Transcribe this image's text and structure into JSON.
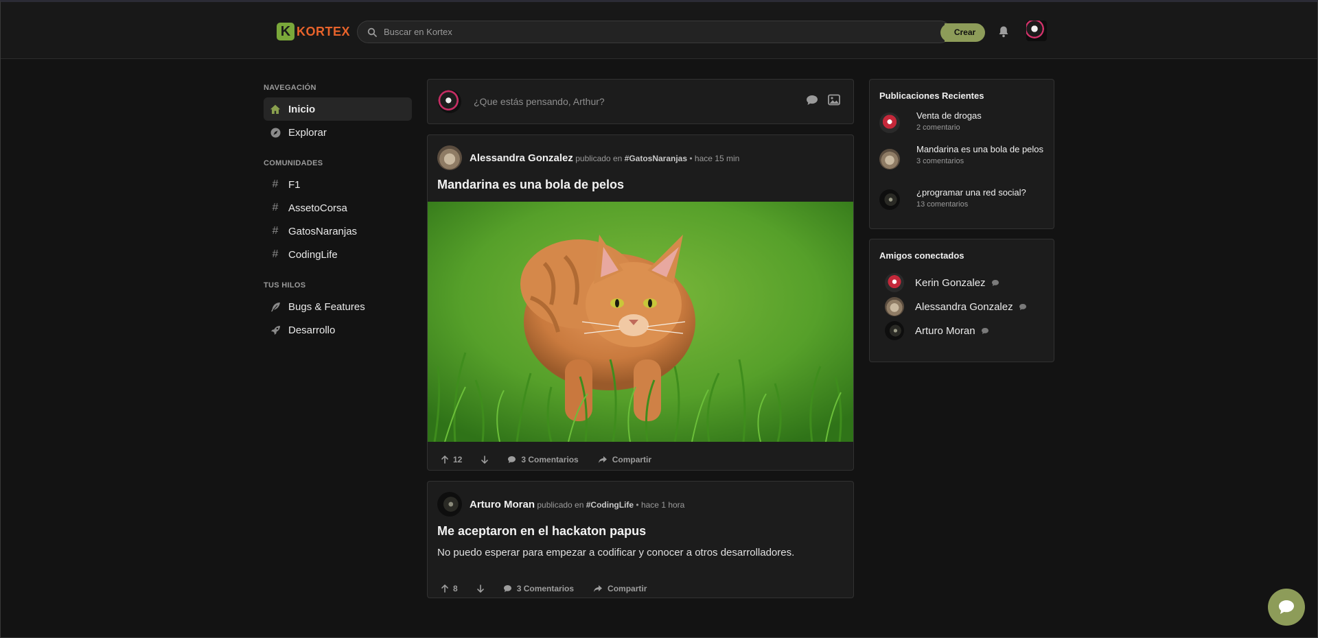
{
  "header": {
    "logo_letter": "K",
    "logo_text": "KORTEX",
    "search_placeholder": "Buscar en Kortex",
    "create_label": "Crear"
  },
  "sidebar": {
    "nav_heading": "NAVEGACIÓN",
    "nav_items": [
      {
        "label": "Inicio",
        "icon": "home-icon",
        "active": true
      },
      {
        "label": "Explorar",
        "icon": "compass-icon",
        "active": false
      }
    ],
    "communities_heading": "COMUNIDADES",
    "communities": [
      {
        "label": "F1",
        "icon": "#"
      },
      {
        "label": "AssetoCorsa",
        "icon": "#"
      },
      {
        "label": "GatosNaranjas",
        "icon": "#"
      },
      {
        "label": "CodingLife",
        "icon": "#"
      }
    ],
    "threads_heading": "TUS HILOS",
    "threads": [
      {
        "label": "Bugs & Features",
        "icon": "feather-icon"
      },
      {
        "label": "Desarrollo",
        "icon": "rocket-icon"
      }
    ]
  },
  "composer": {
    "placeholder": "¿Que estás pensando, Arthur?"
  },
  "posts": [
    {
      "author": "Alessandra Gonzalez",
      "posted_in": "publicado en",
      "community": "#GatosNaranjas",
      "time": "• hace 15 min",
      "title": "Mandarina es una bola de pelos",
      "upvotes": "12",
      "comments": "3 Comentarios",
      "share": "Compartir"
    },
    {
      "author": "Arturo Moran",
      "posted_in": "publicado en",
      "community": "#CodingLife",
      "time": "• hace 1 hora",
      "title": "Me aceptaron en el hackaton papus",
      "body": "No puedo esperar para empezar a codificar y conocer a otros desarrolladores.",
      "upvotes": "8",
      "comments": "3 Comentarios",
      "share": "Compartir"
    }
  ],
  "recent": {
    "title": "Publicaciones Recientes",
    "items": [
      {
        "title": "Venta de drogas",
        "sub": "2 comentario"
      },
      {
        "title": "Mandarina es una bola de pelos",
        "sub": "3 comentarios"
      },
      {
        "title": "¿programar una red social?",
        "sub": "13 comentarios"
      }
    ]
  },
  "friends": {
    "title": "Amigos conectados",
    "items": [
      {
        "name": "Kerin Gonzalez"
      },
      {
        "name": "Alessandra Gonzalez"
      },
      {
        "name": "Arturo Moran"
      }
    ]
  },
  "colors": {
    "accent": "#8d9c59",
    "logo_orange": "#e8632b",
    "logo_green": "#7aa83a",
    "background": "#131313",
    "card": "#1c1c1c"
  }
}
